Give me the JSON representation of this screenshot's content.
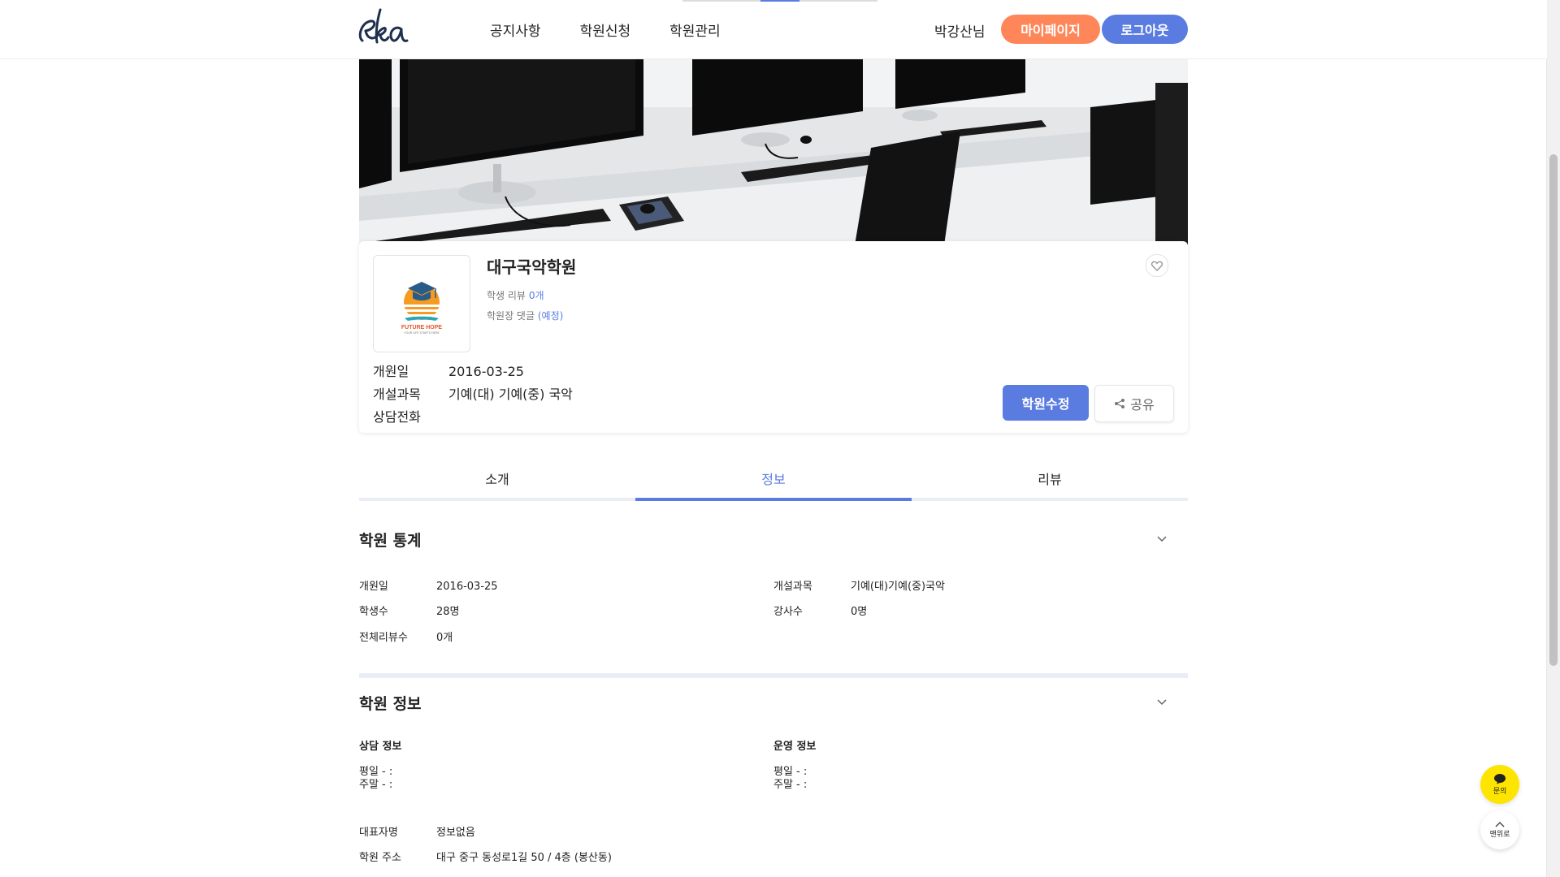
{
  "header": {
    "logo_text": "eka",
    "nav": [
      "공지사항",
      "학원신청",
      "학원관리"
    ],
    "user_name": "박강산님",
    "mypage_label": "마이페이지",
    "logout_label": "로그아웃"
  },
  "academy": {
    "name": "대구국악학원",
    "review_prefix": "학생 리뷰",
    "review_count": "0개",
    "reply_prefix": "학원장 댓글",
    "reply_status": "(예정)",
    "logo_text": "FUTURE HOPE",
    "logo_subtext": "YOUR LIFE STARTS HERE",
    "fields": [
      {
        "label": "개원일",
        "value": "2016-03-25"
      },
      {
        "label": "개설과목",
        "value": "기예(대) 기예(중) 국악"
      },
      {
        "label": "상담전화",
        "value": ""
      }
    ],
    "edit_label": "학원수정",
    "share_label": "공유"
  },
  "tabs": [
    {
      "label": "소개",
      "active": false
    },
    {
      "label": "정보",
      "active": true
    },
    {
      "label": "리뷰",
      "active": false
    }
  ],
  "stats_section": {
    "title": "학원 통계",
    "items": [
      {
        "label": "개원일",
        "value": "2016-03-25"
      },
      {
        "label": "학생수",
        "value": "28명"
      },
      {
        "label": "전체리뷰수",
        "value": "0개"
      },
      {
        "label": "개설과목",
        "value": "기예(대)기예(중)국악"
      },
      {
        "label": "강사수",
        "value": "0명"
      }
    ]
  },
  "info_section": {
    "title": "학원 정보",
    "consult_title": "상담 정보",
    "consult_lines": [
      "평일 - :",
      "주말 - :"
    ],
    "ops_title": "운영 정보",
    "ops_lines": [
      "평일 - :",
      "주말 - :"
    ],
    "rep_label": "대표자명",
    "rep_value": "정보없음",
    "addr_label": "학원 주소",
    "addr_value": "대구 중구 동성로1길 50 / 4층 (봉산동)"
  },
  "floating": {
    "chat_label": "문의",
    "top_label": "맨위로"
  },
  "colors": {
    "primary": "#5a7be0",
    "orange": "#ff8659",
    "kakao": "#fee500"
  }
}
